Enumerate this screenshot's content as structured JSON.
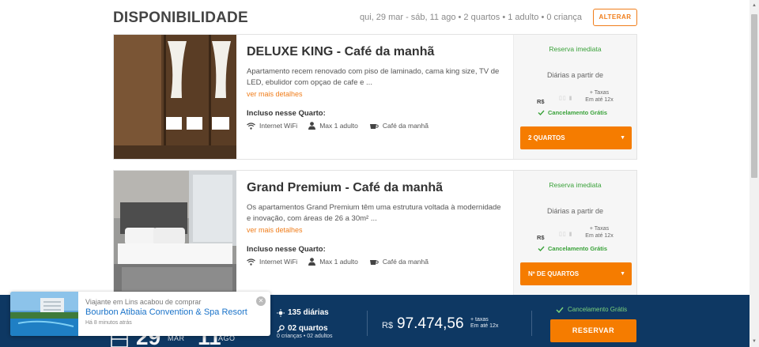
{
  "availability": {
    "title": "DISPONIBILIDADE",
    "summary": "qui, 29 mar - sáb, 11 ago • 2 quartos • 1 adulto • 0 criança",
    "alter_label": "ALTERAR"
  },
  "rooms": [
    {
      "name": "DELUXE KING - Café da manhã",
      "description": "Apartamento recem renovado com piso de laminado, cama king size, TV de LED, ebulidor com opçao de cafe e ...",
      "more_label": "ver mais detalhes",
      "included_title": "Incluso nesse Quarto:",
      "amenities": [
        "Internet WiFi",
        "Max 1 adulto",
        "Café da manhã"
      ],
      "instant_label": "Reserva imediata",
      "from_label": "Diárias a partir de",
      "currency": "R$",
      "taxes_line1": "+ Taxas",
      "taxes_line2": "Em até 12x",
      "cancel_label": "Cancelamento Grátis",
      "select_label": "2 QUARTOS"
    },
    {
      "name": "Grand Premium - Café da manhã",
      "description": "Os apartamentos Grand Premium têm uma estrutura voltada à modernidade e inovação, com áreas de 26 a 30m² ...",
      "more_label": "ver mais detalhes",
      "included_title": "Incluso nesse Quarto:",
      "amenities": [
        "Internet WiFi",
        "Max 1 adulto",
        "Café da manhã"
      ],
      "instant_label": "Reserva imediata",
      "from_label": "Diárias a partir de",
      "currency": "R$",
      "taxes_line1": "+ Taxas",
      "taxes_line2": "Em até 12x",
      "cancel_label": "Cancelamento Grátis",
      "select_label": "Nº DE QUARTOS"
    }
  ],
  "booking_bar": {
    "checkin_day": "29",
    "checkin_month": "MAR",
    "checkout_day": "11",
    "checkout_month": "AGO",
    "nights": "135 diárias",
    "rooms": "02 quartos",
    "guests": "0 crianças • 02 adultos",
    "currency": "R$",
    "total": "97.474,56",
    "taxes_line1": "+ taxas",
    "taxes_line2": "Em até 12x",
    "cancel_label": "Cancelamento Grátis",
    "book_label": "RESERVAR"
  },
  "toast": {
    "line1": "Viajante em Lins acabou de comprar",
    "hotel": "Bourbon Atibaia Convention & Spa Resort",
    "time": "Há 8 minutos atrás"
  },
  "colors": {
    "accent": "#f57c00",
    "success": "#3aa23a",
    "bar": "#0e3863",
    "link": "#1a73c9"
  }
}
